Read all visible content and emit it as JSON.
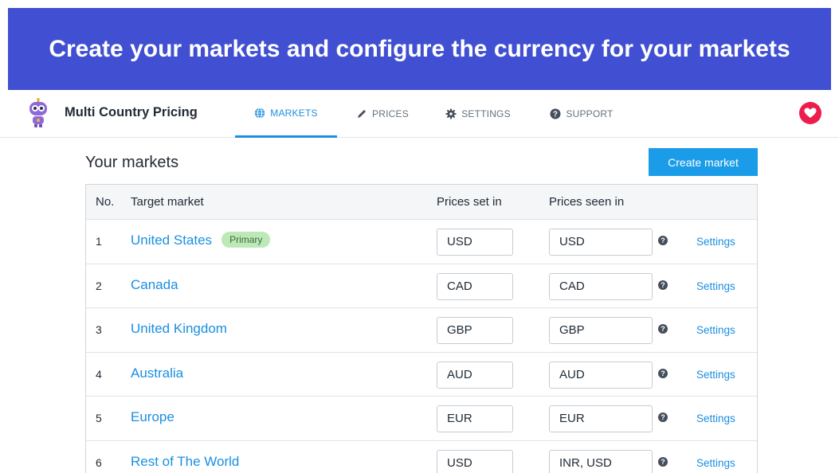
{
  "banner": {
    "text": "Create your markets and configure the currency for your markets"
  },
  "app": {
    "title": "Multi Country Pricing"
  },
  "nav": {
    "tabs": [
      {
        "label": "MARKETS",
        "icon": "globe-icon",
        "active": true
      },
      {
        "label": "PRICES",
        "icon": "pencil-icon",
        "active": false
      },
      {
        "label": "SETTINGS",
        "icon": "gear-icon",
        "active": false
      },
      {
        "label": "SUPPORT",
        "icon": "question-circle-icon",
        "active": false
      }
    ],
    "right_icon": "heart-icon"
  },
  "page": {
    "title": "Your markets",
    "create_button": "Create market"
  },
  "table": {
    "headers": {
      "no": "No.",
      "market": "Target market",
      "set_in": "Prices set in",
      "seen_in": "Prices seen in"
    },
    "rows": [
      {
        "no": "1",
        "market": "United States",
        "badge": "Primary",
        "set_in": "USD",
        "seen_in": "USD",
        "action": "Settings"
      },
      {
        "no": "2",
        "market": "Canada",
        "set_in": "CAD",
        "seen_in": "CAD",
        "action": "Settings"
      },
      {
        "no": "3",
        "market": "United Kingdom",
        "set_in": "GBP",
        "seen_in": "GBP",
        "action": "Settings"
      },
      {
        "no": "4",
        "market": "Australia",
        "set_in": "AUD",
        "seen_in": "AUD",
        "action": "Settings"
      },
      {
        "no": "5",
        "market": "Europe",
        "set_in": "EUR",
        "seen_in": "EUR",
        "action": "Settings"
      },
      {
        "no": "6",
        "market": "Rest of The World",
        "set_in": "USD",
        "seen_in": "INR, USD",
        "action": "Settings"
      }
    ]
  },
  "colors": {
    "banner_bg": "#4150d2",
    "accent": "#1a9ce8",
    "link": "#1a8fe0",
    "badge_bg": "#bde8b8",
    "heart": "#ec1d4c"
  }
}
